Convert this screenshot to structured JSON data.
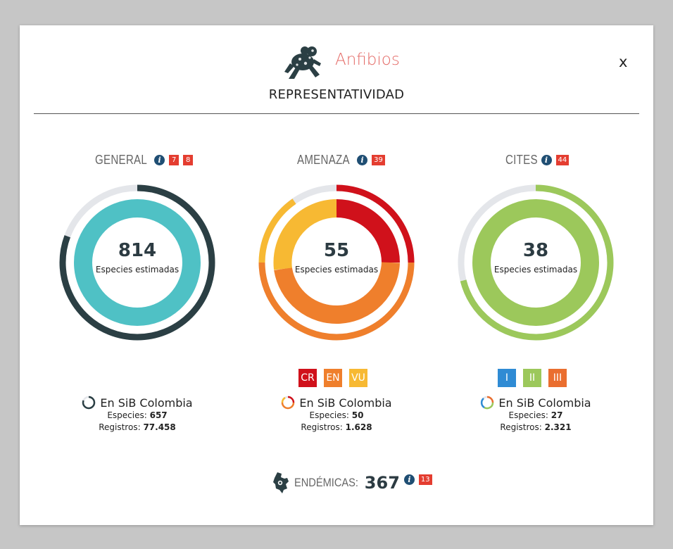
{
  "header": {
    "title": "Anfibios",
    "close_label": "x",
    "subtitle": "REPRESENTATIVIDAD"
  },
  "colors": {
    "general_inner": "#4fc1c5",
    "general_outer": "#2b3f44",
    "track": "#e4e6ea",
    "CR": "#d0111b",
    "EN": "#ef7f2c",
    "VU": "#f7b933",
    "cites_I": "#2f8bd4",
    "cites_II": "#9cc85b",
    "cites_III": "#ea6e2f"
  },
  "general": {
    "label": "GENERAL",
    "badges": [
      "7",
      "8"
    ],
    "value": "814",
    "caption": "Especies estimadas",
    "sib_label": "En SiB Colombia",
    "especies_label": "Especies:",
    "especies": "657",
    "registros_label": "Registros:",
    "registros": "77.458",
    "sib_fraction": 0.807
  },
  "amenaza": {
    "label": "AMENAZA",
    "badges": [
      "39"
    ],
    "value": "55",
    "caption": "Especies estimadas",
    "legend": [
      "CR",
      "EN",
      "VU"
    ],
    "sib_label": "En SiB Colombia",
    "especies_label": "Especies:",
    "especies": "50",
    "registros_label": "Registros:",
    "registros": "1.628",
    "sib_fraction": 0.909
  },
  "cites": {
    "label": "CITES",
    "badges": [
      "44"
    ],
    "value": "38",
    "caption": "Especies estimadas",
    "legend": [
      "I",
      "II",
      "III"
    ],
    "sib_label": "En SiB Colombia",
    "especies_label": "Especies:",
    "especies": "27",
    "registros_label": "Registros:",
    "registros": "2.321",
    "sib_fraction": 0.711
  },
  "endemicas": {
    "label": "ENDÉMICAS:",
    "value": "367",
    "badge": "13"
  }
}
